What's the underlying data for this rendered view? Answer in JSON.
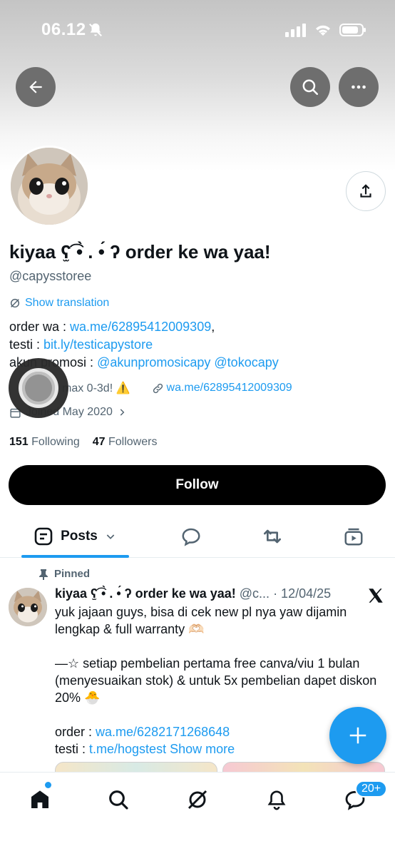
{
  "status_bar": {
    "time": "06.12"
  },
  "profile": {
    "display_name": "kiyaa ʕ̫͡ •̀ . •́ ʔ order ke wa yaa!",
    "display_name_short": "kiyaa",
    "display_name_tail": "order ke wa yaa!",
    "handle": "@capysstoree",
    "show_translation": "Show translation",
    "bio": {
      "line1_prefix": "order wa : ",
      "line1_link": "wa.me/62895412009309",
      "line1_suffix": ",",
      "line2_prefix": "testi : ",
      "line2_link": "bit.ly/testicapystore",
      "line3_prefix": "akun promosi : ",
      "line3_link": "@akunpromosicapy @tokocapy"
    },
    "location": "max 0-3d! ⚠️",
    "website": "wa.me/62895412009309",
    "joined": "Joined May 2020",
    "following_count": "151",
    "following_label": "Following",
    "followers_count": "47",
    "followers_label": "Followers",
    "follow_button": "Follow"
  },
  "tabs": {
    "posts_label": "Posts"
  },
  "pinned_post": {
    "pinned_label": "Pinned",
    "author": "kiyaa ʕ̫͡ •̀ . •́ ʔ order ke wa yaa!",
    "handle": "@c...",
    "date": "· 12/04/25",
    "text1": "yuk jajaan guys, bisa di cek new pl nya yaw dijamin lengkap & full warranty 🫶🏻",
    "text2": "—☆ setiap pembelian pertama free canva/viu 1 bulan (menyesuaikan stok) & untuk 5x pembelian dapet diskon 20% 🐣",
    "order_prefix": "order : ",
    "order_link": "wa.me/6282171268648",
    "testi_prefix": "testi : ",
    "testi_link": "t.me/hogstest",
    "show_more": "Show more"
  },
  "bottom_nav": {
    "messages_badge": "20+"
  },
  "colors": {
    "accent": "#1d9bf0",
    "text": "#0f1419",
    "muted": "#536471"
  },
  "icons": [
    "back-arrow-icon",
    "search-icon",
    "more-icon",
    "share-icon",
    "translate-icon",
    "link-icon",
    "calendar-icon",
    "chevron-right-icon",
    "posts-icon",
    "chevron-down-icon",
    "replies-icon",
    "repost-icon",
    "media-icon",
    "pin-icon",
    "x-logo-icon",
    "plus-icon",
    "home-icon",
    "explore-icon",
    "grok-icon",
    "notifications-icon",
    "messages-icon"
  ]
}
